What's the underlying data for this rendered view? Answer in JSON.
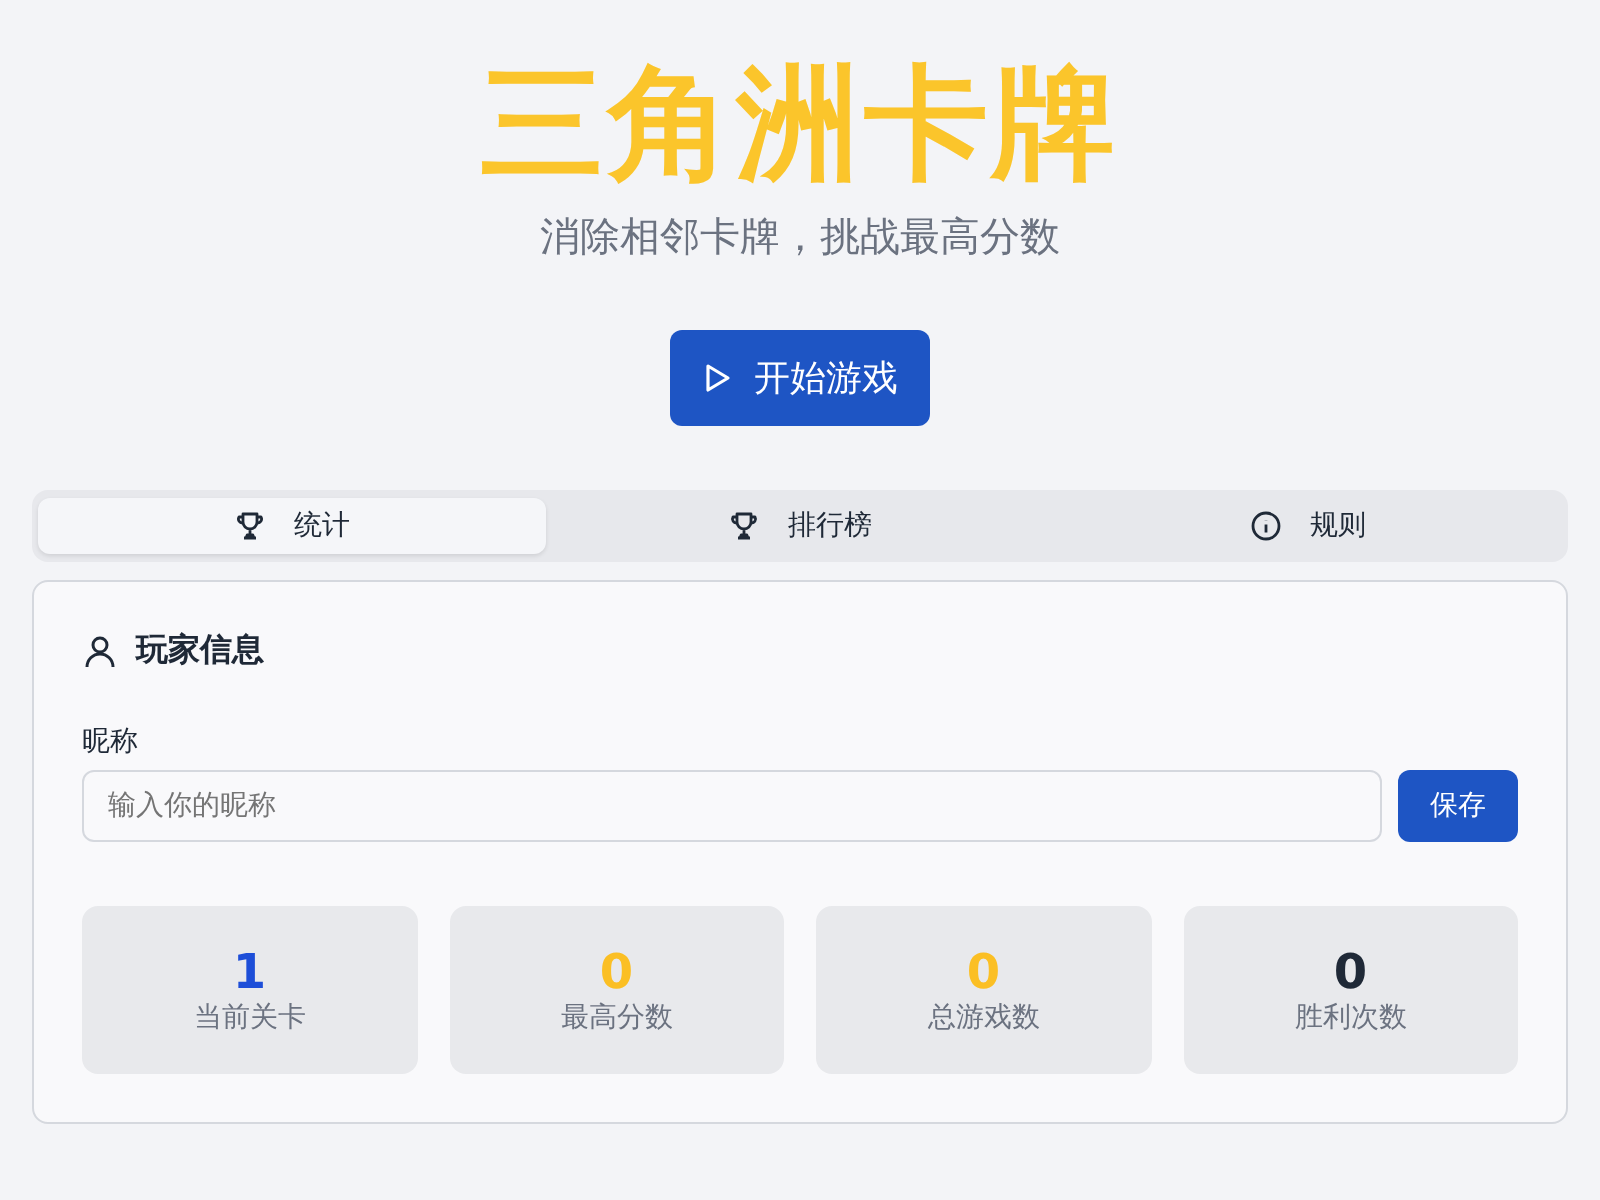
{
  "title": "三角洲卡牌",
  "subtitle": "消除相邻卡牌，挑战最高分数",
  "start_button": {
    "label": "开始游戏"
  },
  "tabs": [
    {
      "label": "统计",
      "kind": "trophy",
      "selected": true
    },
    {
      "label": "排行榜",
      "kind": "trophy",
      "selected": false
    },
    {
      "label": "规则",
      "kind": "info",
      "selected": false
    }
  ],
  "player_card": {
    "heading": "玩家信息",
    "nickname_label": "昵称",
    "nickname_placeholder": "输入你的昵称",
    "save_button": "保存"
  },
  "stats": [
    {
      "value": "1",
      "label": "当前关卡",
      "color": "#1d4ed8"
    },
    {
      "value": "0",
      "label": "最高分数",
      "color": "#fbbf24"
    },
    {
      "value": "0",
      "label": "总游戏数",
      "color": "#fbbf24"
    },
    {
      "value": "0",
      "label": "胜利次数",
      "color": "#1f2937"
    }
  ]
}
